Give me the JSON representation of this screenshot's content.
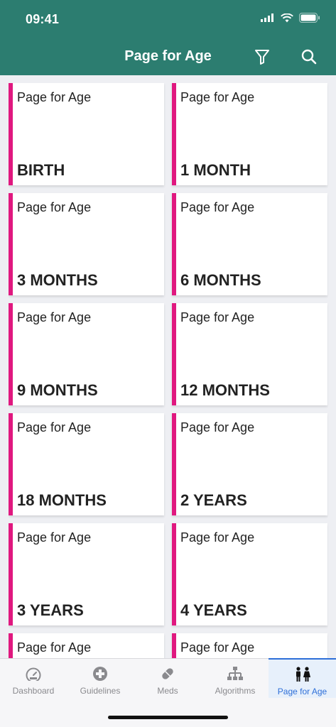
{
  "status": {
    "time": "09:41"
  },
  "header": {
    "title": "Page for Age"
  },
  "cards": [
    {
      "top": "Page for Age",
      "age": "BIRTH"
    },
    {
      "top": "Page for Age",
      "age": "1 MONTH"
    },
    {
      "top": "Page for Age",
      "age": "3 MONTHS"
    },
    {
      "top": "Page for Age",
      "age": "6 MONTHS"
    },
    {
      "top": "Page for Age",
      "age": "9 MONTHS"
    },
    {
      "top": "Page for Age",
      "age": "12 MONTHS"
    },
    {
      "top": "Page for Age",
      "age": "18 MONTHS"
    },
    {
      "top": "Page for Age",
      "age": "2 YEARS"
    },
    {
      "top": "Page for Age",
      "age": "3 YEARS"
    },
    {
      "top": "Page for Age",
      "age": "4 YEARS"
    },
    {
      "top": "Page for Age",
      "age": ""
    },
    {
      "top": "Page for Age",
      "age": ""
    }
  ],
  "tabs": [
    {
      "label": "Dashboard",
      "icon": "gauge-icon"
    },
    {
      "label": "Guidelines",
      "icon": "plus-circle-icon"
    },
    {
      "label": "Meds",
      "icon": "pill-icon"
    },
    {
      "label": "Algorithms",
      "icon": "flowchart-icon"
    },
    {
      "label": "Page for Age",
      "icon": "people-icon",
      "active": true
    }
  ],
  "colors": {
    "header": "#2c7d70",
    "accent": "#e0187f",
    "active_tab": "#2e6fd8"
  }
}
